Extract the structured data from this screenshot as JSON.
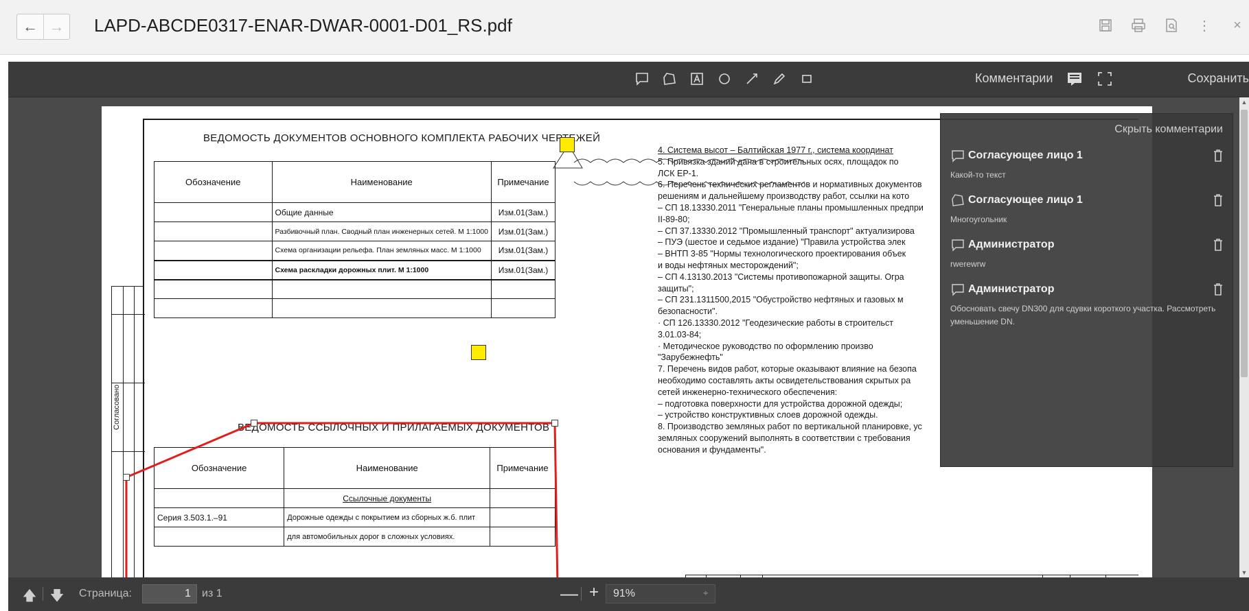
{
  "window": {
    "title": "LAPD-ABCDE0317-ENAR-DWAR-0001-D01_RS.pdf",
    "back_icon": "←",
    "forward_icon": "→",
    "icons": [
      "save-icon",
      "print-icon",
      "preview-icon",
      "more-icon",
      "close-icon"
    ],
    "more_glyph": "⋮",
    "close_glyph": "×"
  },
  "toolbar": {
    "tools": [
      "comment-tool",
      "polygon-tool",
      "text-box-tool",
      "ellipse-tool",
      "line-tool",
      "pencil-tool",
      "rectangle-tool"
    ],
    "comments_label": "Комментарии",
    "save_label": "Сохранить"
  },
  "document": {
    "table1": {
      "title": "ВЕДОМОСТЬ ДОКУМЕНТОВ ОСНОВНОГО КОМПЛЕКТА РАБОЧИХ ЧЕРТЕЖЕЙ",
      "headers": [
        "Обозначение",
        "Наименование",
        "Примечание"
      ],
      "rows": [
        [
          "",
          "Общие данные",
          "Изм.01(Зам.)"
        ],
        [
          "",
          "Разбивочный план. Сводный план инженерных сетей. М 1:1000",
          "Изм.01(Зам.)"
        ],
        [
          "",
          "Схема организации рельефа. План земляных масс. М 1:1000",
          "Изм.01(Зам.)"
        ],
        [
          "",
          "Схема раскладки дорожных плит. М 1:1000",
          "Изм.01(Зам.)"
        ],
        [
          "",
          "",
          ""
        ],
        [
          "",
          "",
          ""
        ]
      ]
    },
    "table2": {
      "title": "ВЕДОМОСТЬ ССЫЛОЧНЫХ И ПРИЛАГАЕМЫХ ДОКУМЕНТОВ",
      "headers": [
        "Обозначение",
        "Наименование",
        "Примечание"
      ],
      "rows": [
        [
          "",
          "Ссылочные документы",
          ""
        ],
        [
          "Серия 3.503.1.–91",
          "Дорожные одежды с покрытием из сборных ж.б. плит",
          ""
        ],
        [
          "",
          "для автомобильных дорог в сложных условиях.",
          ""
        ]
      ]
    },
    "strip_label": "Согласовано",
    "notes": [
      "4. Система высот – Балтийская 1977 г., система координат",
      "5. Привязка зданий дана в строительных осях, площадок по",
      "ЛСК ЕР-1.",
      "6. Перечень технических регламентов и нормативных документов",
      "решениям и дальнейшему производству работ, ссылки на кото",
      "– СП 18.13330.2011 \"Генеральные планы промышленных предпри",
      "II-89-80;",
      "– СП 37.13330.2012 \"Промышленный транспорт\" актуализирова",
      "– ПУЭ (шестое и седьмое издание) \"Правила устройства элек",
      "– ВНТП 3-85 \"Нормы технологического проектирования объек",
      "и воды нефтяных месторождений\";",
      "– СП 4.13130.2013 \"Системы противопожарной защиты. Огра",
      "защиты\";",
      "– СП 231.1311500,2015 \"Обустройство нефтяных и газовых м",
      "безопасности\".",
      "· СП 126.13330.2012 \"Геодезические работы в строительст",
      "3.01.03-84;",
      "· Методическое руководство по оформлению произво",
      "\"Зарубежнефть\"",
      "7. Перечень видов работ, которые оказывают влияние на безопа",
      "необходимо составлять акты освидетельствования скрытых ра",
      "сетей инженерно-технического обеспечения:",
      "– подготовка поверхности для устройства дорожной одежды;",
      "– устройство конструктивных слоев дорожной одежды.",
      "8. Производство земляных работ по вертикальной планировке, ус",
      "земляных сооружений выполнять в соответствии с требования",
      "основания и фундаменты\"."
    ]
  },
  "comments_panel": {
    "hide_label": "Скрыть комментарии",
    "items": [
      {
        "author": "Согласующее лицо 1",
        "text": "Какой-то текст",
        "icon": "speech-bubble-icon"
      },
      {
        "author": "Согласующее лицо 1",
        "text": "Многоугольник",
        "icon": "polygon-icon"
      },
      {
        "author": "Администратор",
        "text": "rwerewrw",
        "icon": "speech-bubble-icon"
      },
      {
        "author": "Администратор",
        "text": "Обосновать свечу DN300 для сдувки короткого участка. Рассмотреть уменьшение DN.",
        "icon": "speech-bubble-icon"
      }
    ]
  },
  "statusbar": {
    "up_icon": "🡅",
    "down_icon": "🡇",
    "page_label": "Страница:",
    "page_value": "1",
    "page_of": "из 1",
    "zoom_minus": "—",
    "zoom_plus": "+",
    "zoom_value": "91%",
    "zoom_chevron": "÷"
  },
  "colors": {
    "annotation_line": "#e01e1e",
    "marker": "#ffeb00",
    "toolbar_bg": "#3b3b3b"
  }
}
